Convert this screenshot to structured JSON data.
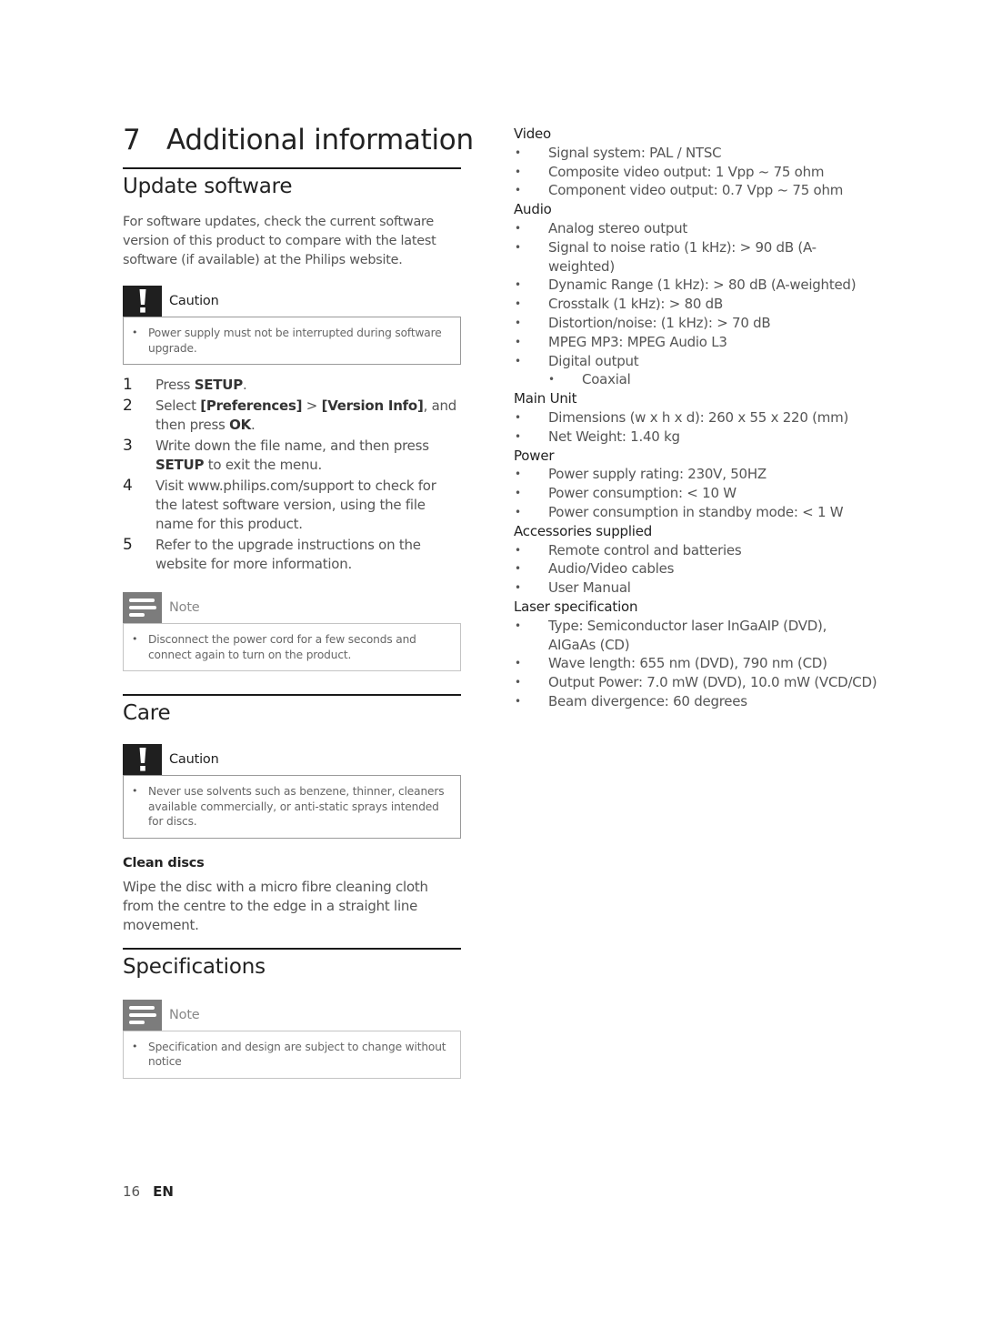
{
  "chapter": {
    "number": "7",
    "title": "Additional information"
  },
  "update_software": {
    "title": "Update software",
    "intro": "For software updates, check the current software version of this product to compare with the latest software (if available) at the Philips website.",
    "caution": {
      "label": "Caution",
      "icon": "exclamation-icon",
      "items": [
        "Power supply must not be interrupted during software upgrade."
      ]
    },
    "steps": [
      {
        "n": "1",
        "parts": [
          {
            "t": "Press "
          },
          {
            "b": "SETUP"
          },
          {
            "t": "."
          }
        ]
      },
      {
        "n": "2",
        "parts": [
          {
            "t": "Select "
          },
          {
            "b": "[Preferences]"
          },
          {
            "t": " > "
          },
          {
            "b": "[Version Info]"
          },
          {
            "t": ", and then press "
          },
          {
            "b": "OK"
          },
          {
            "t": "."
          }
        ]
      },
      {
        "n": "3",
        "parts": [
          {
            "t": "Write down the file name, and then press "
          },
          {
            "b": "SETUP"
          },
          {
            "t": " to exit the menu."
          }
        ]
      },
      {
        "n": "4",
        "parts": [
          {
            "t": "Visit www.philips.com/support to check for the latest software version, using the file name for this product."
          }
        ]
      },
      {
        "n": "5",
        "parts": [
          {
            "t": "Refer to the upgrade instructions on the website for more information."
          }
        ]
      }
    ],
    "note": {
      "label": "Note",
      "icon": "note-lines-icon",
      "items": [
        "Disconnect the power cord for a few seconds and connect again to turn on the product."
      ]
    }
  },
  "care": {
    "title": "Care",
    "caution": {
      "label": "Caution",
      "icon": "exclamation-icon",
      "items": [
        "Never use solvents such as benzene, thinner, cleaners available commercially, or anti-static sprays intended for discs."
      ]
    },
    "clean_discs": {
      "title": "Clean discs",
      "text": "Wipe the disc with a micro fibre cleaning cloth from the centre to the edge in a straight line movement."
    }
  },
  "specifications": {
    "title": "Specifications",
    "note": {
      "label": "Note",
      "icon": "note-lines-icon",
      "items": [
        "Specification and design are subject to change without notice"
      ]
    },
    "groups": [
      {
        "title": "Video",
        "items": [
          {
            "text": "Signal system: PAL / NTSC"
          },
          {
            "text": "Composite video output: 1 Vpp ~ 75 ohm"
          },
          {
            "text": "Component video output: 0.7 Vpp ~ 75 ohm"
          }
        ]
      },
      {
        "title": "Audio",
        "items": [
          {
            "text": "Analog stereo output"
          },
          {
            "text": "Signal to noise ratio (1 kHz): > 90 dB (A-weighted)"
          },
          {
            "text": "Dynamic Range (1 kHz): > 80 dB (A-weighted)"
          },
          {
            "text": "Crosstalk (1 kHz): > 80 dB"
          },
          {
            "text": "Distortion/noise: (1 kHz): > 70 dB"
          },
          {
            "text": "MPEG MP3: MPEG Audio L3"
          },
          {
            "text": "Digital output",
            "sub": [
              "Coaxial"
            ]
          }
        ]
      },
      {
        "title": "Main Unit",
        "items": [
          {
            "text": "Dimensions (w x h x d): 260 x 55 x 220 (mm)"
          },
          {
            "text": "Net Weight: 1.40 kg"
          }
        ]
      },
      {
        "title": "Power",
        "items": [
          {
            "text": "Power supply rating: 230V, 50HZ"
          },
          {
            "text": "Power consumption: < 10 W"
          },
          {
            "text": "Power consumption in standby mode: < 1 W"
          }
        ]
      },
      {
        "title": "Accessories supplied",
        "items": [
          {
            "text": "Remote control and batteries"
          },
          {
            "text": "Audio/Video cables"
          },
          {
            "text": "User Manual"
          }
        ]
      },
      {
        "title": "Laser specification",
        "items": [
          {
            "text": "Type: Semiconductor laser InGaAIP (DVD), AIGaAs (CD)"
          },
          {
            "text": "Wave length: 655 nm (DVD), 790 nm (CD)"
          },
          {
            "text": "Output Power: 7.0 mW (DVD), 10.0 mW (VCD/CD)"
          },
          {
            "text": "Beam divergence: 60 degrees"
          }
        ]
      }
    ]
  },
  "footer": {
    "page_number": "16",
    "language": "EN"
  },
  "glyphs": {
    "bullet": "•"
  }
}
